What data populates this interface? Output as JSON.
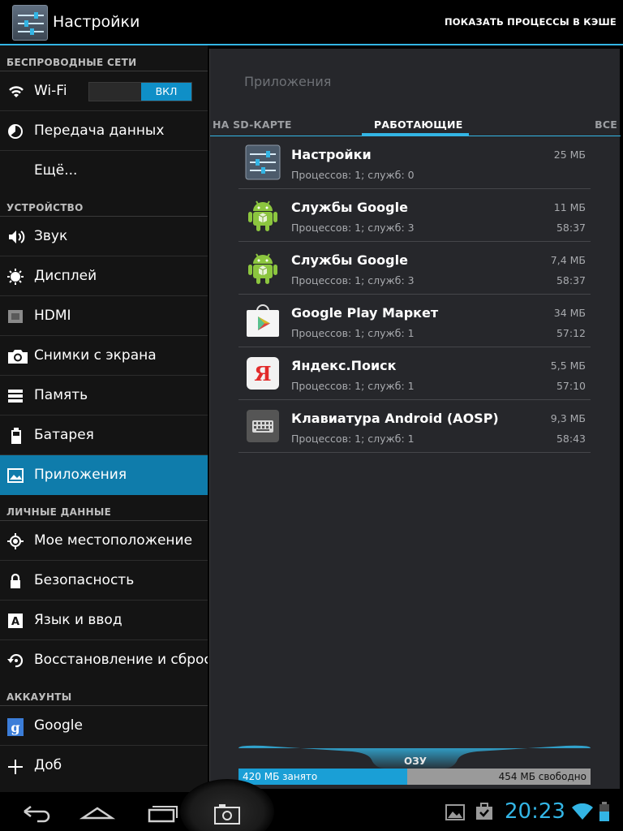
{
  "actionbar": {
    "title": "Настройки",
    "show_cached": "ПОКАЗАТЬ ПРОЦЕССЫ В КЭШЕ"
  },
  "sidebar": {
    "sections": [
      {
        "header": "БЕСПРОВОДНЫЕ СЕТИ",
        "items": [
          {
            "label": "Wi-Fi",
            "icon": "wifi-icon",
            "toggle": "ВКЛ"
          },
          {
            "label": "Передача данных",
            "icon": "data-usage-icon"
          },
          {
            "label": "Ещё...",
            "icon": ""
          }
        ]
      },
      {
        "header": "УСТРОЙСТВО",
        "items": [
          {
            "label": "Звук",
            "icon": "sound-icon"
          },
          {
            "label": "Дисплей",
            "icon": "display-icon"
          },
          {
            "label": "HDMI",
            "icon": "hdmi-icon"
          },
          {
            "label": "Снимки с экрана",
            "icon": "camera-icon"
          },
          {
            "label": "Память",
            "icon": "storage-icon"
          },
          {
            "label": "Батарея",
            "icon": "battery-icon"
          },
          {
            "label": "Приложения",
            "icon": "apps-icon",
            "active": true
          }
        ]
      },
      {
        "header": "ЛИЧНЫЕ ДАННЫЕ",
        "items": [
          {
            "label": "Мое местоположение",
            "icon": "location-icon"
          },
          {
            "label": "Безопасность",
            "icon": "lock-icon"
          },
          {
            "label": "Язык и ввод",
            "icon": "language-icon"
          },
          {
            "label": "Восстановление и сброс",
            "icon": "backup-icon"
          }
        ]
      },
      {
        "header": "АККАУНТЫ",
        "items": [
          {
            "label": "Google",
            "icon": "google-icon"
          },
          {
            "label": "Доб",
            "icon": "add-icon"
          }
        ]
      }
    ]
  },
  "pane": {
    "title": "Приложения",
    "tabs": [
      "НА SD-КАРТЕ",
      "РАБОТАЮЩИЕ",
      "ВСЕ"
    ],
    "apps": [
      {
        "name": "Настройки",
        "info": "Процессов: 1; служб: 0",
        "size": "25 МБ",
        "time": "",
        "icon": "settings-icon"
      },
      {
        "name": "Службы Google",
        "info": "Процессов: 1; служб: 3",
        "size": "11 МБ",
        "time": "58:37",
        "icon": "android-icon"
      },
      {
        "name": "Службы Google",
        "info": "Процессов: 1; служб: 3",
        "size": "7,4 МБ",
        "time": "58:37",
        "icon": "android-icon"
      },
      {
        "name": "Google Play Маркет",
        "info": "Процессов: 1; служб: 1",
        "size": "34 МБ",
        "time": "57:12",
        "icon": "play-store-icon"
      },
      {
        "name": "Яндекс.Поиск",
        "info": "Процессов: 1; служб: 1",
        "size": "5,5 МБ",
        "time": "57:10",
        "icon": "yandex-icon"
      },
      {
        "name": "Клавиатура Android (AOSP)",
        "info": "Процессов: 1; служб: 1",
        "size": "9,3 МБ",
        "time": "58:43",
        "icon": "keyboard-icon"
      }
    ],
    "ram": {
      "label": "ОЗУ",
      "used": "420 МБ занято",
      "free": "454 МБ свободно",
      "used_fraction": 0.48
    }
  },
  "navbar": {
    "clock": "20:23"
  },
  "colors": {
    "accent": "#33b5e5",
    "active_item": "#0f7cab",
    "ram_used": "#1a9fd6"
  }
}
